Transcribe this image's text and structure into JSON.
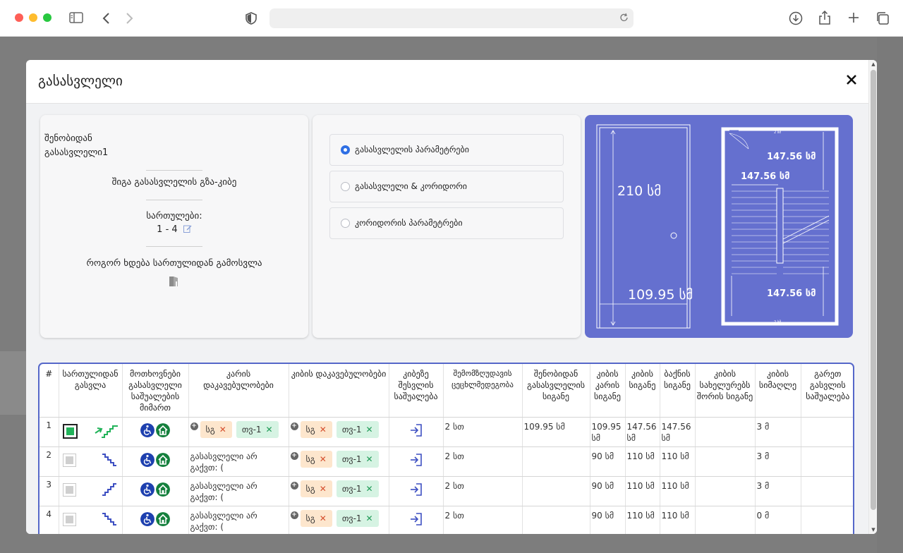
{
  "browser": {
    "url": ""
  },
  "modal": {
    "title": "გასასვლელი",
    "close_label": "✕"
  },
  "left_card": {
    "line1": "შენობიდან",
    "line2": "გასასვლელი1",
    "exit_type": "შიგა გასასვლელის გზა-კიბე",
    "floors_label": "სართულები:",
    "floors_value": "1 - 4",
    "how_exit_label": "როგორ ხდება სართულიდან გამოსვლა"
  },
  "options": [
    {
      "label": "გასასვლელის პარამეტრები",
      "checked": true
    },
    {
      "label": "გასასვლელი & კორიდორი",
      "checked": false
    },
    {
      "label": "კორიდორის პარამეტრები",
      "checked": false
    }
  ],
  "drawing": {
    "door_height": "210 სმ",
    "door_width": "109.95 სმ",
    "landing_top": "147.56 სმ",
    "stair_width": "147.56 სმ",
    "landing_bottom": "147.56 სმ",
    "small_dim": "2 სმ"
  },
  "table": {
    "headers": [
      "#",
      "სართულიდან გასვლა",
      "მოთხოვნები გასასვლელი საშუალების მიმართ",
      "კარის დაკავებულობები",
      "კიბის დაკავებულობები",
      "კიბეზე შესვლის საშუალება",
      "შემომზღუდავის ცეცხლმედეგობა",
      "შენობიდან გასასვლელის სიგანე",
      "კიბის კარის სიგანე",
      "კიბის სიგანე",
      "ბაქნის სიგანე",
      "კიბის სახელურებს შორის სიგანე",
      "კიბის სიმაღლე",
      "გარეთ გასვლის საშუალება"
    ],
    "tag_orange": "სგ",
    "tag_green": "თვ-1",
    "rows": [
      {
        "num": "1",
        "door_note": "",
        "fire": "2 სთ",
        "exit_width": "109.95 სმ",
        "door_w": "109.95 სმ",
        "stair_w": "147.56 სმ",
        "landing_w": "147.56 სმ",
        "rail_w": "",
        "height": "3 მ",
        "outside": ""
      },
      {
        "num": "2",
        "door_note": "გასასვლელი არ გაქვთ: (",
        "fire": "2 სთ",
        "exit_width": "",
        "door_w": "90 სმ",
        "stair_w": "110 სმ",
        "landing_w": "110 სმ",
        "rail_w": "",
        "height": "3 მ",
        "outside": ""
      },
      {
        "num": "3",
        "door_note": "გასასვლელი არ გაქვთ: (",
        "fire": "2 სთ",
        "exit_width": "",
        "door_w": "90 სმ",
        "stair_w": "110 სმ",
        "landing_w": "110 სმ",
        "rail_w": "",
        "height": "3 მ",
        "outside": ""
      },
      {
        "num": "4",
        "door_note": "გასასვლელი არ გაქვთ: (",
        "fire": "2 სთ",
        "exit_width": "",
        "door_w": "90 სმ",
        "stair_w": "110 სმ",
        "landing_w": "110 სმ",
        "rail_w": "",
        "height": "0 მ",
        "outside": ""
      }
    ]
  },
  "colors": {
    "accent_blue": "#2f6fe4",
    "drawing_bg": "#6570cf",
    "table_border": "#5567c9",
    "stair_icon_green": "#22b35a",
    "stair_icon_blue": "#3d4fc2",
    "badge_blue": "#1e40af",
    "badge_green": "#15803d"
  }
}
